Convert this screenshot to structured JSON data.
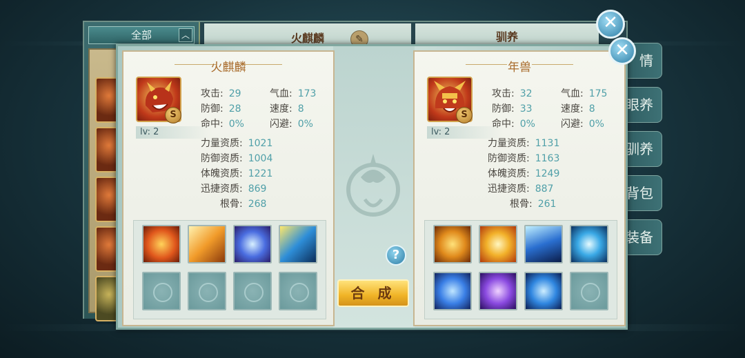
{
  "background": {
    "list_header": "全部",
    "list_arrow": "︿",
    "tab_pet_name": "火麒麟",
    "tab_train": "驯养",
    "side_tabs": [
      "情",
      "眼养",
      "驯养",
      "背包",
      "装备"
    ]
  },
  "dialog": {
    "merge_label": "合 成",
    "help_label": "?",
    "close_label": "✕"
  },
  "pets": [
    {
      "name": "火麒麟",
      "rank": "S",
      "level": "lv: 2",
      "stats": [
        {
          "label": "攻击:",
          "value": "29"
        },
        {
          "label": "气血:",
          "value": "173"
        },
        {
          "label": "防御:",
          "value": "28"
        },
        {
          "label": "速度:",
          "value": "8"
        },
        {
          "label": "命中:",
          "value": "0%"
        },
        {
          "label": "闪避:",
          "value": "0%"
        }
      ],
      "aptitudes": [
        {
          "label": "力量资质:",
          "value": "1021"
        },
        {
          "label": "防御资质:",
          "value": "1004"
        },
        {
          "label": "体魄资质:",
          "value": "1221"
        },
        {
          "label": "迅捷资质:",
          "value": "869"
        },
        {
          "label": "根骨:",
          "value": "268"
        }
      ],
      "skills": [
        "fire-shield-skill-icon",
        "fire-strike-skill-icon",
        "blue-shield-skill-icon",
        "water-blade-skill-icon",
        "empty",
        "empty",
        "empty",
        "empty"
      ]
    },
    {
      "name": "年兽",
      "rank": "S",
      "level": "lv: 2",
      "stats": [
        {
          "label": "攻击:",
          "value": "32"
        },
        {
          "label": "气血:",
          "value": "175"
        },
        {
          "label": "防御:",
          "value": "33"
        },
        {
          "label": "速度:",
          "value": "8"
        },
        {
          "label": "命中:",
          "value": "0%"
        },
        {
          "label": "闪避:",
          "value": "0%"
        }
      ],
      "aptitudes": [
        {
          "label": "力量资质:",
          "value": "1131"
        },
        {
          "label": "防御资质:",
          "value": "1163"
        },
        {
          "label": "体魄资质:",
          "value": "1249"
        },
        {
          "label": "迅捷资质:",
          "value": "887"
        },
        {
          "label": "根骨:",
          "value": "261"
        }
      ],
      "skills": [
        "tiger-roar-skill-icon",
        "golden-burst-skill-icon",
        "ice-spikes-skill-icon",
        "crossed-blades-skill-icon",
        "blue-heart-skill-icon",
        "purple-vortex-skill-icon",
        "blue-beast-skill-icon",
        "empty"
      ]
    }
  ]
}
